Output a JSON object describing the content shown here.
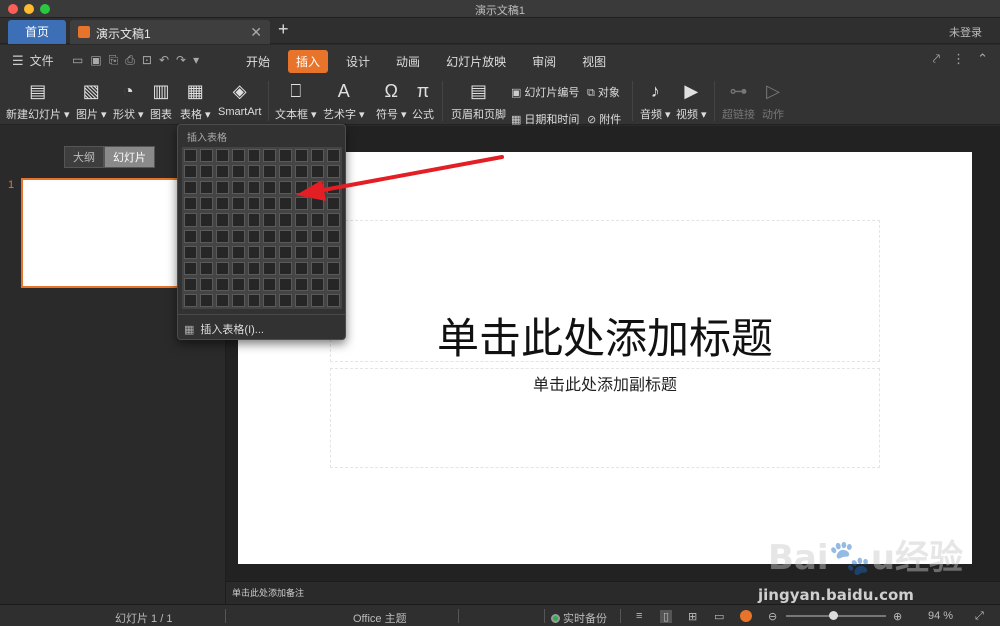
{
  "window": {
    "title": "演示文稿1"
  },
  "tabs": {
    "home": "首页",
    "doc": "演示文稿1",
    "login": "未登录"
  },
  "menubar": {
    "file": "文件",
    "tabs": [
      "开始",
      "插入",
      "设计",
      "动画",
      "幻灯片放映",
      "审阅",
      "视图"
    ],
    "active": "插入"
  },
  "ribbon": {
    "new_slide": "新建幻灯片",
    "picture": "图片",
    "shape": "形状",
    "chart": "图表",
    "table": "表格",
    "smartart": "SmartArt",
    "textbox": "文本框",
    "wordart": "艺术字",
    "symbol": "符号",
    "formula": "公式",
    "header_footer": "页眉和页脚",
    "slide_number": "幻灯片编号",
    "object": "对象",
    "date_time": "日期和时间",
    "attachment": "附件",
    "audio": "音频",
    "video": "视频",
    "hyperlink": "超链接",
    "action": "动作"
  },
  "left_panel": {
    "outline": "大纲",
    "slides": "幻灯片",
    "slide_number": "1"
  },
  "slide": {
    "title": "单击此处添加标题",
    "subtitle": "单击此处添加副标题"
  },
  "notes": {
    "placeholder": "单击此处添加备注"
  },
  "dropdown": {
    "header": "插入表格",
    "menu_item": "插入表格(I)...",
    "grid_rows": 10,
    "grid_cols": 10
  },
  "status": {
    "slide_info": "幻灯片 1 / 1",
    "theme": "Office 主题",
    "backup": "实时备份",
    "zoom": "94 %",
    "zoom_level": 0.47
  },
  "watermark": {
    "site": "jingyan.baidu.com"
  },
  "colors": {
    "accent": "#e8742b",
    "home_tab": "#3d6fb6",
    "arrow": "#e31e24"
  }
}
